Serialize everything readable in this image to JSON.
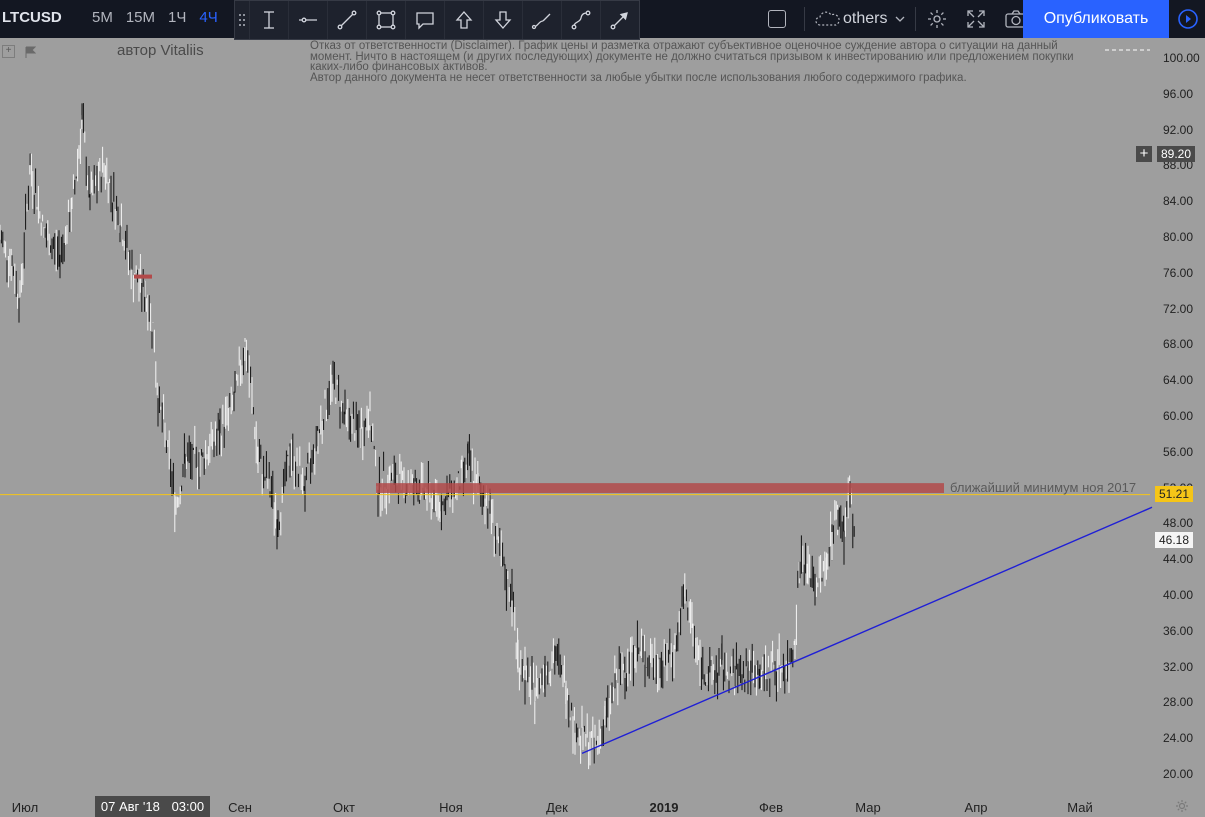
{
  "header": {
    "symbol": "LTCUSD",
    "intervals": [
      {
        "label": "5M",
        "active": false
      },
      {
        "label": "15M",
        "active": false
      },
      {
        "label": "1Ч",
        "active": false
      },
      {
        "label": "4Ч",
        "active": true
      }
    ],
    "drawing_tools": [
      "text-cursor-icon",
      "horizontal-line-icon",
      "trend-line-icon",
      "rectangle-icon",
      "callout-icon",
      "arrow-up-icon",
      "arrow-down-icon",
      "brush-icon",
      "path-icon",
      "arrow-line-icon"
    ],
    "layout_name": "others",
    "publish_label": "Опубликовать",
    "accent_color": "#2962ff"
  },
  "chart": {
    "author": "автор Vitaliis",
    "disclaimer_lines": [
      "Отказ от ответственности (Disclaimer). График цены и разметка отражают субъективное оценочное суждение автора о ситуации на данный",
      "момент. Ничто в настоящем (и других последующих) документе не должно считаться призывом к инвестированию или предложением покупки",
      "каких-либо финансовых активов.",
      "Автор данного документа не несет ответственности за любые убытки после использования любого содержимого графика."
    ],
    "zone_label": "ближайший минимум ноя 2017",
    "price_ticks": [
      "100.00",
      "96.00",
      "92.00",
      "88.00",
      "84.00",
      "80.00",
      "76.00",
      "72.00",
      "68.00",
      "64.00",
      "60.00",
      "56.00",
      "52.00",
      "48.00",
      "44.00",
      "40.00",
      "36.00",
      "32.00",
      "28.00",
      "24.00",
      "20.00"
    ],
    "crosshair_price": "89.20",
    "level_price": "51.21",
    "current_price": "46.18",
    "time_labels": [
      {
        "label": "Июл",
        "bold": false
      },
      {
        "label": "Сен",
        "bold": false
      },
      {
        "label": "Окт",
        "bold": false
      },
      {
        "label": "Ноя",
        "bold": false
      },
      {
        "label": "Дек",
        "bold": false
      },
      {
        "label": "2019",
        "bold": true
      },
      {
        "label": "Фев",
        "bold": false
      },
      {
        "label": "Мар",
        "bold": false
      },
      {
        "label": "Апр",
        "bold": false
      },
      {
        "label": "Май",
        "bold": false
      }
    ],
    "cursor_date": "07 Авг '18",
    "cursor_time": "03:00",
    "colors": {
      "background": "#9e9e9e",
      "zone": "#b24a4a",
      "level_line": "#f5c518",
      "trendline": "#1f1fd6",
      "candles": "#111111"
    }
  }
}
